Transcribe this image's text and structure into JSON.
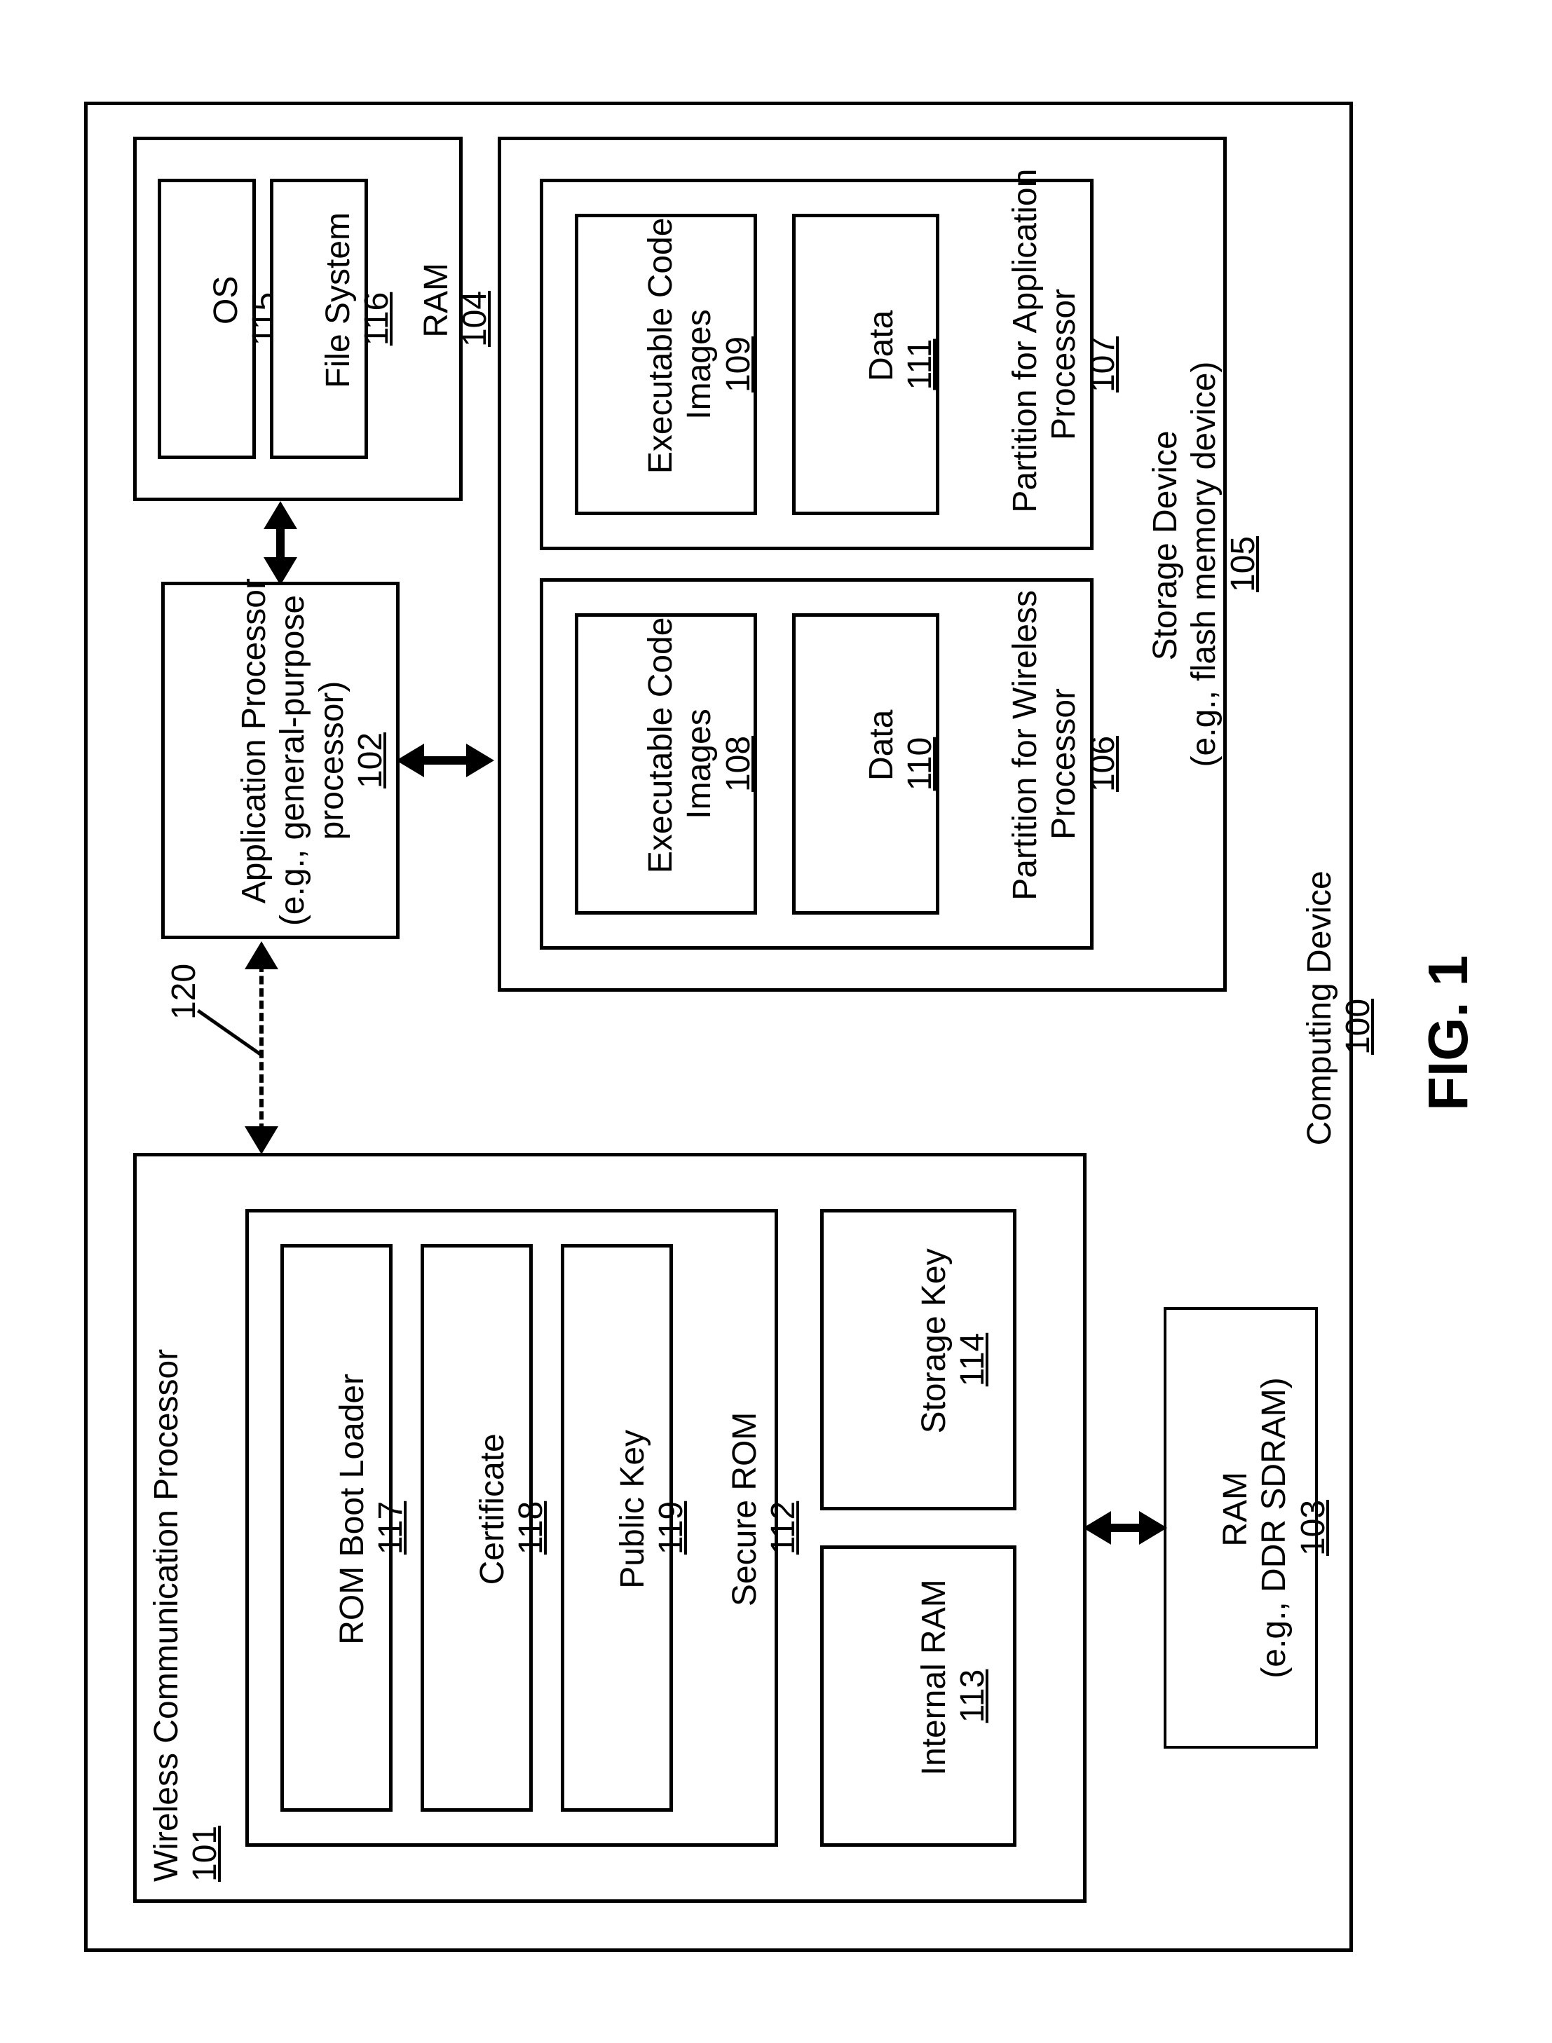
{
  "figure_label": "FIG. 1",
  "device": {
    "name": "Computing Device",
    "ref": "100"
  },
  "wcp": {
    "name": "Wireless Communication Processor",
    "ref": "101",
    "secure_rom": {
      "name": "Secure ROM",
      "ref": "112",
      "boot_loader": {
        "name": "ROM Boot Loader",
        "ref": "117"
      },
      "certificate": {
        "name": "Certificate",
        "ref": "118"
      },
      "public_key": {
        "name": "Public Key",
        "ref": "119"
      }
    },
    "internal_ram": {
      "name": "Internal RAM",
      "ref": "113"
    },
    "storage_key": {
      "name": "Storage Key",
      "ref": "114"
    }
  },
  "ram_ext": {
    "name": "RAM\n(e.g., DDR SDRAM)",
    "ref": "103"
  },
  "link_ref": "120",
  "app_proc": {
    "name": "Application Processor\n(e.g., general-purpose\nprocessor)",
    "ref": "102"
  },
  "ram_ap": {
    "name": "RAM",
    "ref": "104",
    "os": {
      "name": "OS",
      "ref": "115"
    },
    "fs": {
      "name": "File System",
      "ref": "116"
    }
  },
  "storage": {
    "name": "Storage Device\n(e.g., flash memory device)",
    "ref": "105",
    "part_wp": {
      "name": "Partition for Wireless\nProcessor",
      "ref": "106",
      "exec": {
        "name": "Executable Code\nImages",
        "ref": "108"
      },
      "data": {
        "name": "Data",
        "ref": "110"
      }
    },
    "part_ap": {
      "name": "Partition for Application\nProcessor",
      "ref": "107",
      "exec": {
        "name": "Executable Code\nImages",
        "ref": "109"
      },
      "data": {
        "name": "Data",
        "ref": "111"
      }
    }
  }
}
